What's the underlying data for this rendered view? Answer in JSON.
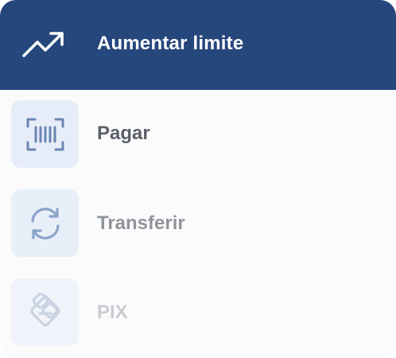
{
  "menu": {
    "header": {
      "label": "Aumentar limite",
      "icon": "trending-up-icon",
      "bg": "#26477c"
    },
    "items": [
      {
        "label": "Pagar",
        "icon": "barcode-scan-icon"
      },
      {
        "label": "Transferir",
        "icon": "refresh-arrows-icon"
      },
      {
        "label": "PIX",
        "icon": "pix-icon"
      }
    ]
  }
}
